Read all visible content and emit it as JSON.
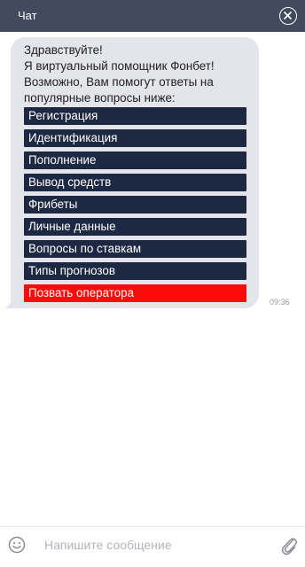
{
  "header": {
    "title": "Чат",
    "close_icon": "close-circle-icon"
  },
  "message": {
    "greeting_lines": [
      "Здравствуйте!",
      "Я виртуальный помощник Фонбет!",
      "Возможно, Вам помогут ответы на",
      "популярные вопросы ниже:"
    ],
    "options": [
      "Регистрация",
      "Идентификация",
      "Пополнение",
      "Вывод средств",
      "Фрибеты",
      "Личные данные",
      "Вопросы по ставкам",
      "Типы прогнозов"
    ],
    "operator_button": "Позвать оператора",
    "time": "09:36"
  },
  "composer": {
    "placeholder": "Напишите сообщение",
    "emoji_icon": "emoji-icon",
    "attach_icon": "paperclip-icon"
  },
  "colors": {
    "header_bg": "#444a5e",
    "bubble_bg": "#e4e5ea",
    "option_bg": "#1d2943",
    "operator_bg": "#fe0a0a"
  }
}
